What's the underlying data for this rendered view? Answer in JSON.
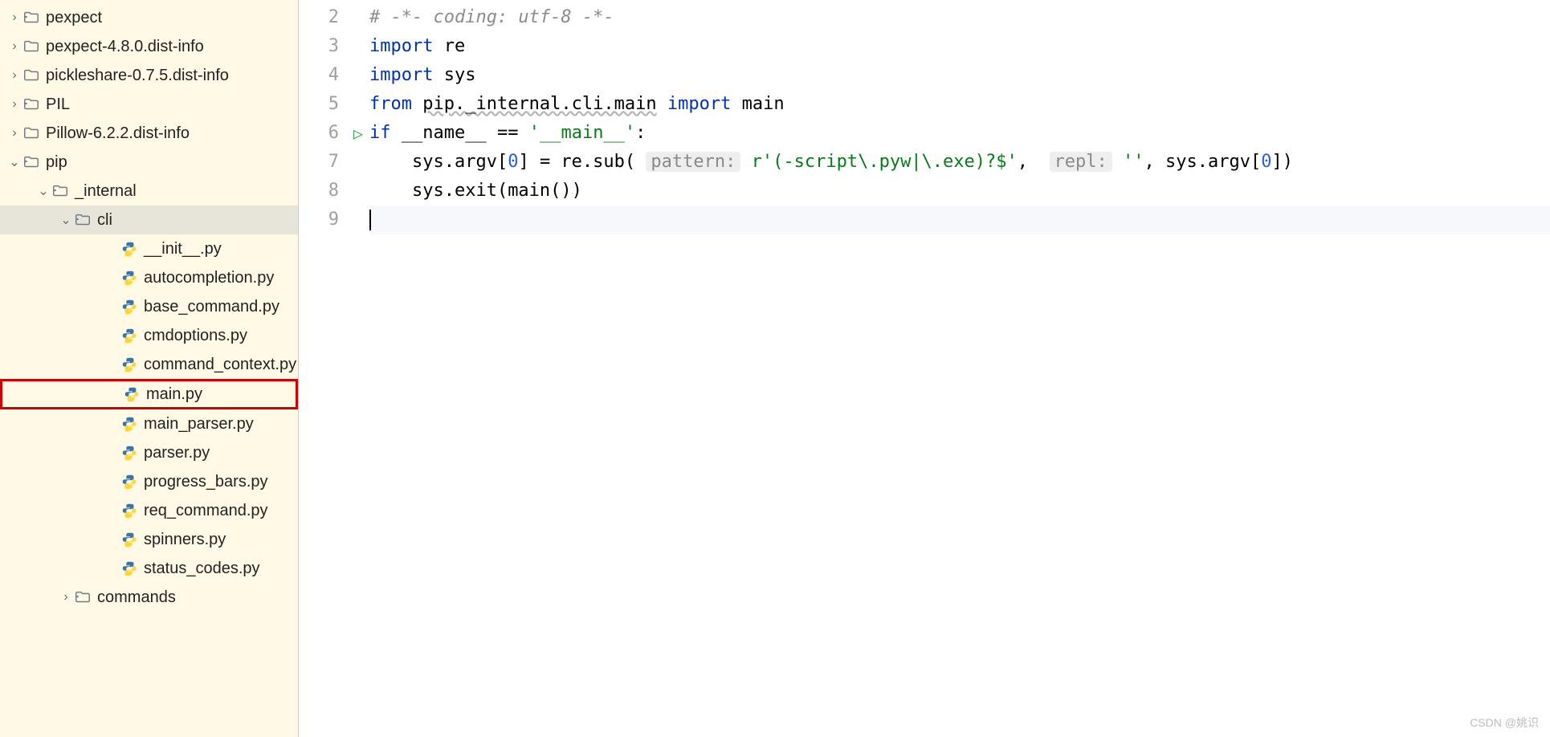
{
  "tree": {
    "items": [
      {
        "depth": 0,
        "arrow": "right",
        "icon": "folder-dot",
        "label": "pexpect",
        "sel": false
      },
      {
        "depth": 0,
        "arrow": "right",
        "icon": "folder",
        "label": "pexpect-4.8.0.dist-info",
        "sel": false
      },
      {
        "depth": 0,
        "arrow": "right",
        "icon": "folder",
        "label": "pickleshare-0.7.5.dist-info",
        "sel": false
      },
      {
        "depth": 0,
        "arrow": "right",
        "icon": "folder-dot",
        "label": "PIL",
        "sel": false
      },
      {
        "depth": 0,
        "arrow": "right",
        "icon": "folder",
        "label": "Pillow-6.2.2.dist-info",
        "sel": false
      },
      {
        "depth": 0,
        "arrow": "down",
        "icon": "folder-dot",
        "label": "pip",
        "sel": false
      },
      {
        "depth": 1,
        "arrow": "down",
        "icon": "folder-dot",
        "label": "_internal",
        "sel": false
      },
      {
        "depth": 2,
        "arrow": "down",
        "icon": "folder-dot",
        "label": "cli",
        "sel": true
      },
      {
        "depth": 3,
        "arrow": "none",
        "icon": "py",
        "label": "__init__.py",
        "sel": false
      },
      {
        "depth": 3,
        "arrow": "none",
        "icon": "py",
        "label": "autocompletion.py",
        "sel": false
      },
      {
        "depth": 3,
        "arrow": "none",
        "icon": "py",
        "label": "base_command.py",
        "sel": false
      },
      {
        "depth": 3,
        "arrow": "none",
        "icon": "py",
        "label": "cmdoptions.py",
        "sel": false
      },
      {
        "depth": 3,
        "arrow": "none",
        "icon": "py",
        "label": "command_context.py",
        "sel": false
      },
      {
        "depth": 3,
        "arrow": "none",
        "icon": "py",
        "label": "main.py",
        "sel": false,
        "hl": true
      },
      {
        "depth": 3,
        "arrow": "none",
        "icon": "py",
        "label": "main_parser.py",
        "sel": false
      },
      {
        "depth": 3,
        "arrow": "none",
        "icon": "py",
        "label": "parser.py",
        "sel": false
      },
      {
        "depth": 3,
        "arrow": "none",
        "icon": "py",
        "label": "progress_bars.py",
        "sel": false
      },
      {
        "depth": 3,
        "arrow": "none",
        "icon": "py",
        "label": "req_command.py",
        "sel": false
      },
      {
        "depth": 3,
        "arrow": "none",
        "icon": "py",
        "label": "spinners.py",
        "sel": false
      },
      {
        "depth": 3,
        "arrow": "none",
        "icon": "py",
        "label": "status_codes.py",
        "sel": false
      },
      {
        "depth": 2,
        "arrow": "right",
        "icon": "folder-dot",
        "label": "commands",
        "sel": false
      }
    ]
  },
  "gutter": {
    "lines": [
      "2",
      "3",
      "4",
      "5",
      "6",
      "7",
      "8",
      "9"
    ],
    "run_marker_line": "6"
  },
  "code": {
    "l2": {
      "comment": "# -*- coding: utf-8 -*-"
    },
    "l3": {
      "kw": "import",
      "mod": "re"
    },
    "l4": {
      "kw": "import",
      "mod": "sys"
    },
    "l5": {
      "kw1": "from",
      "mod": "pip._internal.cli.main",
      "kw2": "import",
      "name": "main"
    },
    "l6": {
      "kw": "if",
      "bi": "__name__",
      "op": "==",
      "str": "'__main__'",
      "colon": ":"
    },
    "l7": {
      "indent": "    ",
      "pre": "sys.argv[",
      "idx0a": "0",
      "mid1": "] = re.sub( ",
      "hint1": "pattern:",
      "sp1": " ",
      "rprefix": "r",
      "q1": "'",
      "regex": "(-script\\.pyw|\\.exe)?$",
      "q2": "'",
      "comma": ",  ",
      "hint2": "repl:",
      "sp2": " ",
      "empty": "''",
      "tail": ", sys.argv[",
      "idx0b": "0",
      "close": "])"
    },
    "l8": {
      "indent": "    ",
      "txt": "sys.exit(main())"
    }
  },
  "watermark": "CSDN @姚识"
}
